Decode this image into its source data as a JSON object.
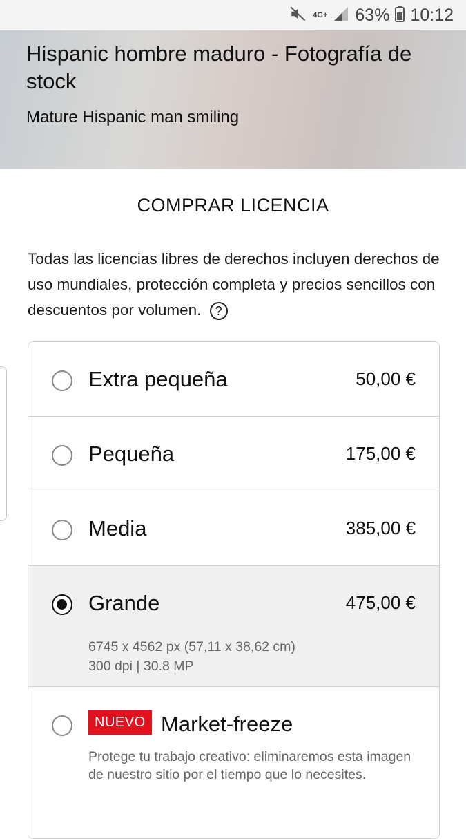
{
  "status_bar": {
    "network": "4G+",
    "battery": "63%",
    "time": "10:12",
    "icons": [
      "mute-icon",
      "signal-icon",
      "battery-icon"
    ]
  },
  "header": {
    "title": "Hispanic hombre maduro - Fotografía de stock",
    "subtitle": "Mature Hispanic man smiling"
  },
  "license": {
    "heading": "COMPRAR LICENCIA",
    "intro": "Todas las licencias libres de derechos incluyen derechos de uso mundiales, protección completa y precios sencillos con descuentos por volumen.",
    "help_symbol": "?",
    "options": [
      {
        "name": "Extra pequeña",
        "price": "50,00 €",
        "selected": false
      },
      {
        "name": "Pequeña",
        "price": "175,00 €",
        "selected": false
      },
      {
        "name": "Media",
        "price": "385,00 €",
        "selected": false
      },
      {
        "name": "Grande",
        "price": "475,00 €",
        "selected": true,
        "detail_line1": "6745 x 4562 px (57,11 x 38,62 cm)",
        "detail_line2": "300 dpi | 30.8 MP"
      },
      {
        "name": "Market-freeze",
        "badge": "NUEVO",
        "selected": false,
        "description": "Protege tu trabajo creativo: eliminaremos esta imagen de nuestro sitio por el tiempo que lo necesites."
      }
    ]
  },
  "colors": {
    "badge": "#e3101e",
    "selected_row": "#f0f0f0"
  }
}
